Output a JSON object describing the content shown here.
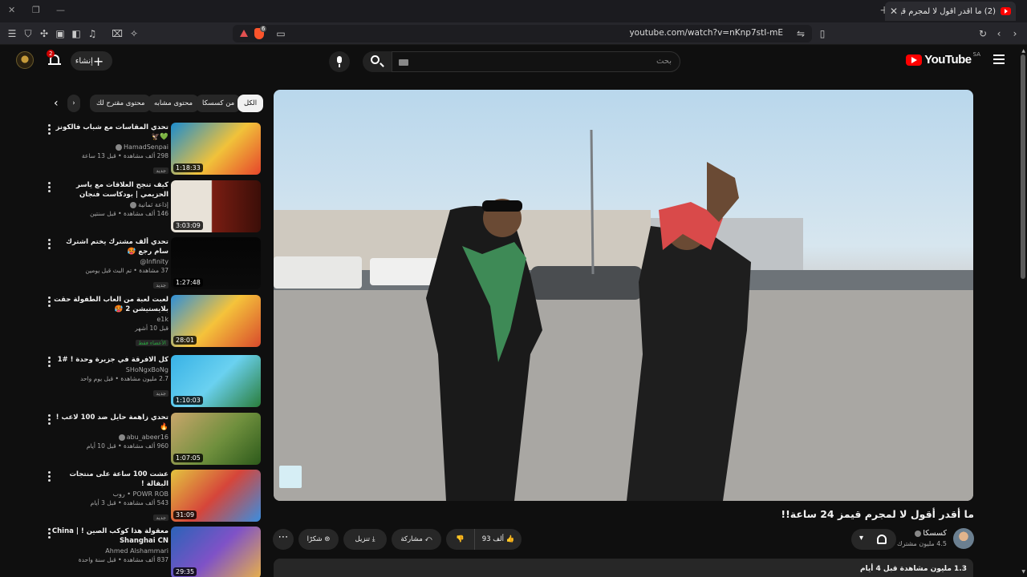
{
  "browser": {
    "tab_title": "(2) ما أقدر أقول لا لمجرم قيمز 24 ساعة",
    "url": "youtube.com/watch?v=nKnp7stI-mE",
    "brave_badge": "6"
  },
  "header": {
    "logo_text": "YouTube",
    "country": "SA",
    "search_placeholder": "بحث",
    "create_label": "إنشاء",
    "notif_count": "2"
  },
  "chips": [
    {
      "label": "الكل",
      "active": true
    },
    {
      "label": "من كسسكا"
    },
    {
      "label": "محتوى مشابه"
    },
    {
      "label": "محتوى مقترح لك"
    }
  ],
  "recommendations": [
    {
      "title": "تحدي المقاسات مع شباب فالكونز 💚🦅",
      "channel": "HamadSenpai",
      "meta": "298 ألف مشاهدة • قبل 13 ساعة",
      "badge": "جديد",
      "duration": "1:18:33",
      "thumb": "linear-gradient(135deg,#1b8ccf,#f1c23a 55%,#e6452b)"
    },
    {
      "title": "كيف تنجح العلاقات مع ياسر الحزيمي | بودكاست فنجان",
      "channel": "إذاعة ثمانية",
      "meta": "146 ألف مشاهدة • قبل سنتين",
      "badge": "",
      "duration": "3:03:09",
      "thumb": "linear-gradient(90deg,#e8e2d8 0 45%,#7a1d12 46%,#3b0e08)"
    },
    {
      "title": "تحدي ألف مشترك يختم اشترك سام رجع 🥵",
      "channel": "Infinity@",
      "meta": "37 مشاهدة • تم البث قبل يومين",
      "badge": "جديد",
      "duration": "1:27:48",
      "thumb": "linear-gradient(#050505,#0b0b0b)"
    },
    {
      "title": "لعبت لعبة من العاب الطفولة حقت بلايستيشن 2 🥵",
      "channel": "e1k",
      "meta": "قبل 10 أشهر",
      "badge": "الأعضاء فقط",
      "duration": "28:01",
      "thumb": "linear-gradient(135deg,#2e8fd8,#f5c33b 50%,#d84a2c)"
    },
    {
      "title": "كل الافرقة في جزيرة وحدة ! #1",
      "channel": "SHoNgxBoNg",
      "meta": "2.7 مليون مشاهدة • قبل يوم واحد",
      "badge": "جديد",
      "duration": "1:10:03",
      "thumb": "linear-gradient(135deg,#38b2e6,#6ad1f0 50%,#2a7d3b)"
    },
    {
      "title": "تحدي زاهمة حايل ضد 100 لاعب ! 🔥",
      "channel": "abu_abeer16",
      "meta": "960 ألف مشاهدة • قبل 10 أيام",
      "badge": "",
      "duration": "1:07:05",
      "thumb": "linear-gradient(135deg,#c9a66b,#6f8f3d 55%,#2d5a1b)"
    },
    {
      "title": "عشت 100 ساعة على منتجات البقالة !",
      "channel": "POWR ROB • روب",
      "meta": "543 ألف مشاهدة • قبل 3 أيام",
      "badge": "جديد",
      "duration": "31:09",
      "thumb": "linear-gradient(135deg,#e3c43f,#d6453a 50%,#3a8ee0)"
    },
    {
      "title": "معقولة هذا كوكب الصين ! China | Shanghai CN",
      "channel": "Ahmed Alshammari",
      "meta": "837 ألف مشاهدة • قبل سنة واحدة",
      "badge": "",
      "duration": "29:35",
      "thumb": "linear-gradient(135deg,#2b63b8,#7f52c7 50%,#e8b04a)"
    }
  ],
  "video": {
    "title": "ما أقدر أقول لا لمجرم قيمز 24 ساعة!!",
    "channel": "كسسكا",
    "subscribers": "4.5 مليون مشترك",
    "likes": "93 ألف",
    "share": "مشاركة",
    "download": "تنزيل",
    "thanks": "شكرًا",
    "description_meta": "1.3 مليون مشاهدة قبل 4 أيام"
  }
}
